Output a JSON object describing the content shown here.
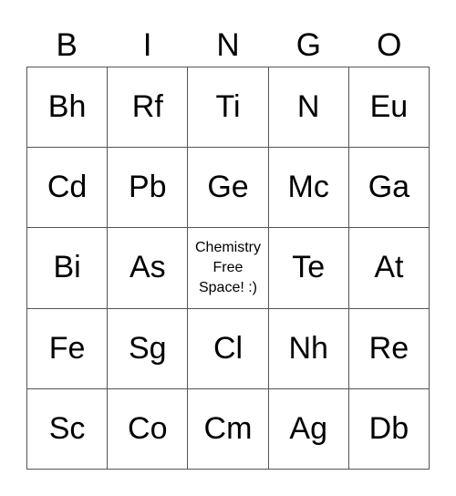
{
  "header": [
    "B",
    "I",
    "N",
    "G",
    "O"
  ],
  "rows": [
    [
      "Bh",
      "Rf",
      "Ti",
      "N",
      "Eu"
    ],
    [
      "Cd",
      "Pb",
      "Ge",
      "Mc",
      "Ga"
    ],
    [
      "Bi",
      "As",
      "Chemistry Free Space! :)",
      "Te",
      "At"
    ],
    [
      "Fe",
      "Sg",
      "Cl",
      "Nh",
      "Re"
    ],
    [
      "Sc",
      "Co",
      "Cm",
      "Ag",
      "Db"
    ]
  ],
  "free_space": {
    "row": 2,
    "col": 2
  }
}
